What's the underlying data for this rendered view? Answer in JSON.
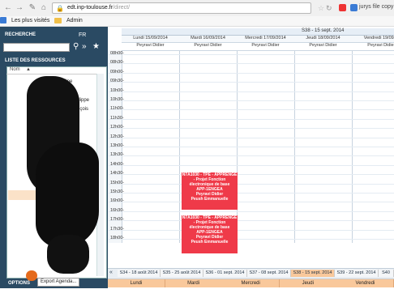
{
  "browser": {
    "url_host": "edt.inp-toulouse.fr",
    "url_rest": "/direct/",
    "search_hint": "jurys file copy",
    "bookmarks": [
      "Les plus visités",
      "Admin"
    ]
  },
  "left": {
    "search_label": "RECHERCHE",
    "lang": "FR",
    "list_title": "LISTE DES RESSOURCES",
    "column": "Nom",
    "items": [
      "lipe",
      "an-Philippe",
      "-François"
    ],
    "options_label": "OPTIONS",
    "tooltip": "Export Agenda..."
  },
  "calendar": {
    "week": "S38 - 15 sept. 2014",
    "days": [
      {
        "date": "Lundi 15/09/2014",
        "person": "Peyravi Didier"
      },
      {
        "date": "Mardi 16/09/2014",
        "person": "Peyravi Didier"
      },
      {
        "date": "Mercredi 17/09/2014",
        "person": "Peyravi Didier"
      },
      {
        "date": "Jeudi 18/09/2014",
        "person": "Peyravi Didier"
      },
      {
        "date": "Vendredi 19/09/2",
        "person": "Peyravi Didie"
      }
    ],
    "times": [
      "08h00-",
      "08h30-",
      "09h00-",
      "09h30-",
      "10h00-",
      "10h30-",
      "11h00-",
      "11h30-",
      "12h00-",
      "12h30-",
      "13h00-",
      "13h30-",
      "14h00-",
      "14h30-",
      "15h00-",
      "15h30-",
      "16h00-",
      "16h30-",
      "17h00-",
      "17h30-",
      "18h00-"
    ],
    "events": [
      {
        "lines": [
          "N7A1030 - TPE - APPRENGE",
          "- Projet Fonction",
          "électronique de base",
          "APP-1ENGEA",
          "Peyravi Didier",
          "Peush Emmanuelle"
        ]
      },
      {
        "lines": [
          "N7A1030 - TPE - APPRENGE",
          "- Projet Fonction",
          "électronique de base",
          "APP-1ENGEA",
          "Peyravi Didier",
          "Peush Emmanuelle"
        ]
      }
    ],
    "day_tabs": [
      "Lundi",
      "Mardi",
      "Mercredi",
      "Jeudi",
      "Vendredi"
    ],
    "week_tabs": [
      "S34 - 18 août 2014",
      "S35 - 25 août 2014",
      "S36 - 01 sept. 2014",
      "S37 - 08 sept. 2014",
      "S38 - 15 sept. 2014",
      "S39 - 22 sept. 2014",
      "S40"
    ]
  }
}
